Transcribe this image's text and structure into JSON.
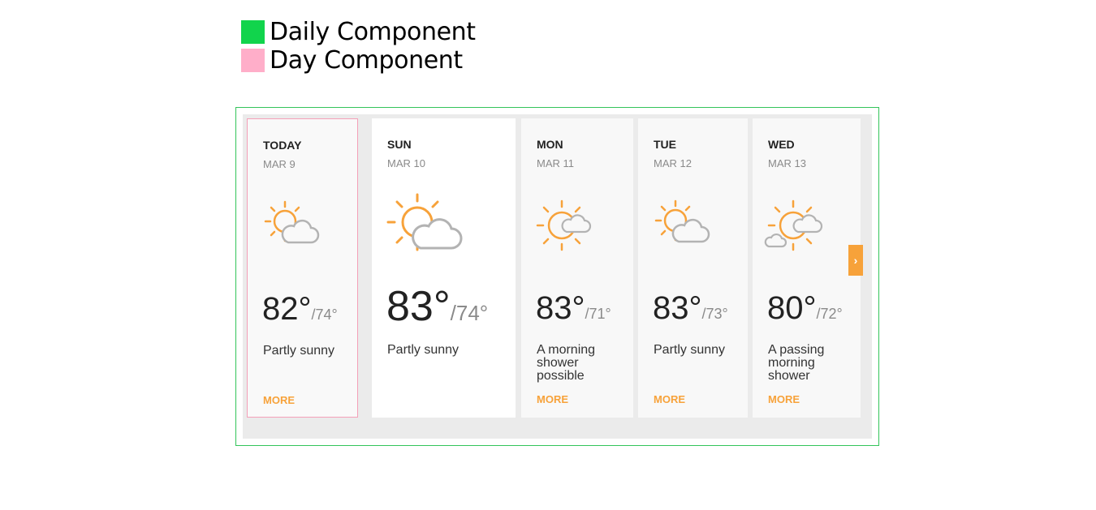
{
  "legend": [
    {
      "label": "Daily Component",
      "color": "#11d44c"
    },
    {
      "label": "Day Component",
      "color": "#ffaec9"
    }
  ],
  "days": [
    {
      "name": "TODAY",
      "date": "MAR 9",
      "hi": "82°",
      "lo": "/74°",
      "condition": "Partly sunny",
      "more": "MORE",
      "icon": "partly-sunny-icon"
    },
    {
      "name": "SUN",
      "date": "MAR 10",
      "hi": "83°",
      "lo": "/74°",
      "condition": "Partly sunny",
      "more": "",
      "icon": "partly-sunny-icon"
    },
    {
      "name": "MON",
      "date": "MAR 11",
      "hi": "83°",
      "lo": "/71°",
      "condition": "A morning shower possible",
      "more": "MORE",
      "icon": "sun-cloud-icon"
    },
    {
      "name": "TUE",
      "date": "MAR 12",
      "hi": "83°",
      "lo": "/73°",
      "condition": "Partly sunny",
      "more": "MORE",
      "icon": "partly-sunny-icon"
    },
    {
      "name": "WED",
      "date": "MAR 13",
      "hi": "80°",
      "lo": "/72°",
      "condition": "A passing morning shower",
      "more": "MORE",
      "icon": "sun-clouds-icon"
    }
  ],
  "next_button": {
    "label": "›",
    "icon": "chevron-right-icon"
  },
  "colors": {
    "accent": "#f7a23a",
    "frame": "#33c45a",
    "today_border": "#f4a0b8"
  }
}
